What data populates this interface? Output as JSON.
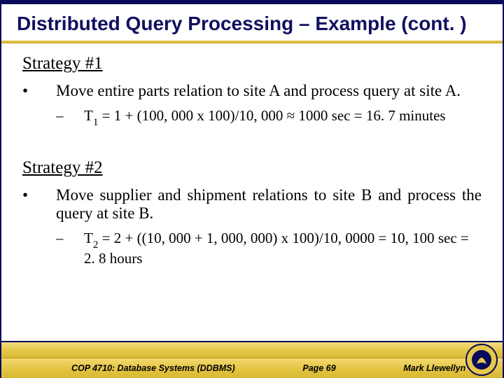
{
  "title": "Distributed Query Processing – Example (cont. )",
  "strategy1": {
    "heading": "Strategy #1",
    "bullet": "Move entire parts relation to site A and process query at site A.",
    "sub_prefix": "T",
    "sub_subscript": "1",
    "sub_rest": " = 1 + (100, 000 x 100)/10, 000 ≈ 1000 sec = 16. 7 minutes"
  },
  "strategy2": {
    "heading": "Strategy #2",
    "bullet": "Move supplier and shipment relations to site B and process the query at site B.",
    "sub_prefix": "T",
    "sub_subscript": "2",
    "sub_rest": " = 2 + ((10, 000 + 1, 000, 000) x 100)/10, 0000 = 10, 100 sec = 2. 8 hours"
  },
  "footer": {
    "course": "COP 4710: Database Systems  (DDBMS)",
    "page": "Page 69",
    "author": "Mark Llewellyn ©"
  }
}
